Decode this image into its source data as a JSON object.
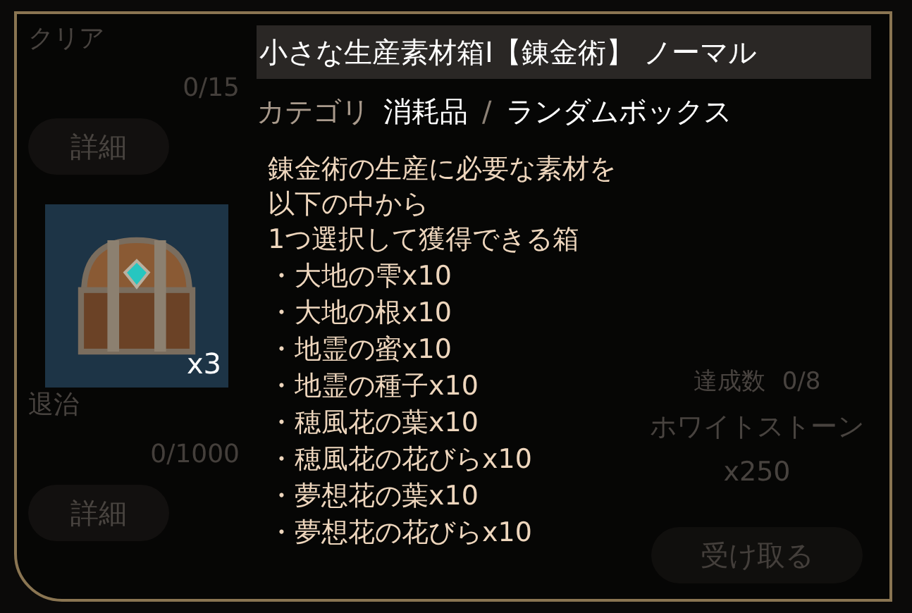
{
  "background": {
    "left_cards": [
      {
        "title": "クリア",
        "progress": "0/15",
        "button": "詳細"
      },
      {
        "title": "退治",
        "progress": "0/1000",
        "button": "詳細"
      }
    ],
    "right_card": {
      "achieved_label": "達成数",
      "achieved": "0/8",
      "reward": "ホワイトストーン",
      "reward_count": "x250",
      "button": "受け取る"
    }
  },
  "tooltip": {
    "title": "小さな生産素材箱I【錬金術】 ノーマル",
    "category_label": "カテゴリ",
    "category": "消耗品",
    "separator": "/",
    "subcategory": "ランダムボックス",
    "item_count": "x3",
    "description_lines": [
      "錬金術の生産に必要な素材を",
      "以下の中から",
      "1つ選択して獲得できる箱"
    ],
    "contents": [
      "・大地の雫x10",
      "・大地の根x10",
      "・地霊の蜜x10",
      "・地霊の種子x10",
      "・穂風花の葉x10",
      "・穂風花の花びらx10",
      "・夢想花の葉x10",
      "・夢想花の花びらx10"
    ]
  }
}
